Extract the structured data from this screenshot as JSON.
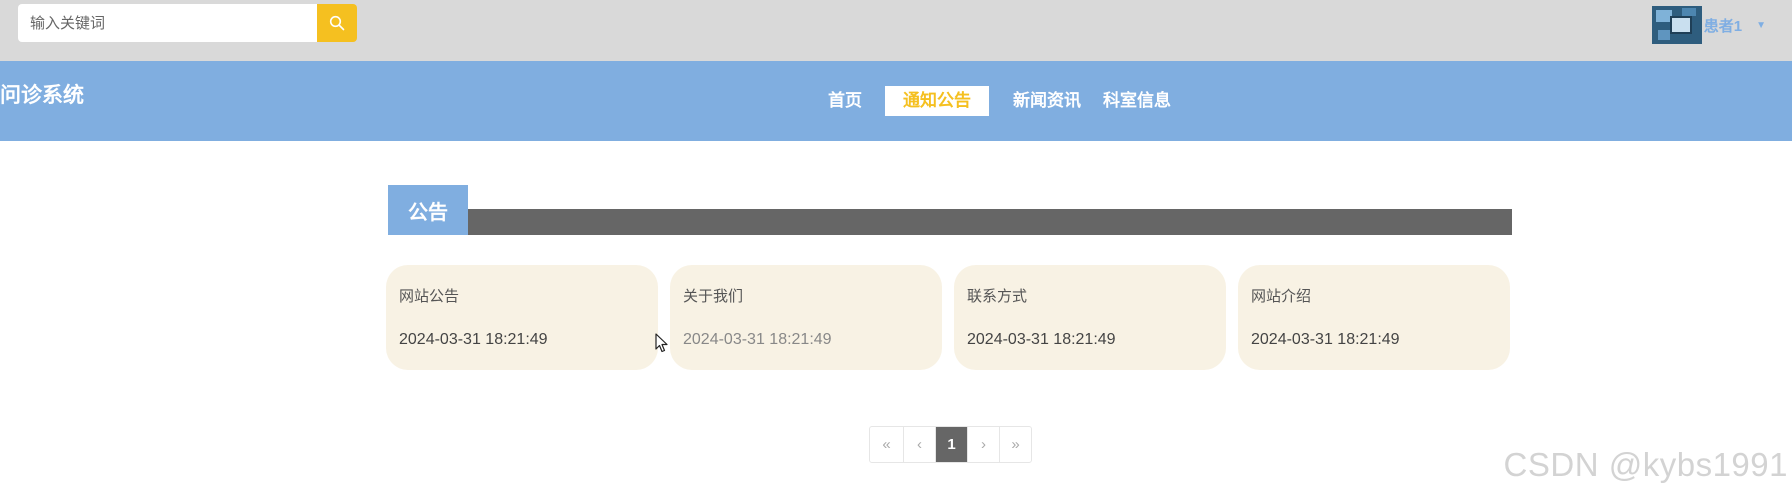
{
  "search": {
    "placeholder": "输入关键词",
    "value": ""
  },
  "user": {
    "name": "患者1"
  },
  "site": {
    "title": "问诊系统"
  },
  "nav": {
    "items": [
      {
        "label": "首页",
        "active": false
      },
      {
        "label": "通知公告",
        "active": true
      },
      {
        "label": "新闻资讯",
        "active": false
      },
      {
        "label": "科室信息",
        "active": false
      }
    ]
  },
  "section": {
    "title": "公告"
  },
  "cards": [
    {
      "title": "网站公告",
      "date": "2024-03-31 18:21:49"
    },
    {
      "title": "关于我们",
      "date": "2024-03-31 18:21:49"
    },
    {
      "title": "联系方式",
      "date": "2024-03-31 18:21:49"
    },
    {
      "title": "网站介绍",
      "date": "2024-03-31 18:21:49"
    }
  ],
  "pagination": {
    "first": "«",
    "prev": "‹",
    "current": "1",
    "next": "›",
    "last": "»"
  },
  "watermark": "CSDN @kybs1991",
  "colors": {
    "accent": "#f5c020",
    "nav_bg": "#80aee0",
    "topbar_bg": "#d9d9d9",
    "card_bg": "#f8f2e4",
    "section_bar": "#666666"
  }
}
